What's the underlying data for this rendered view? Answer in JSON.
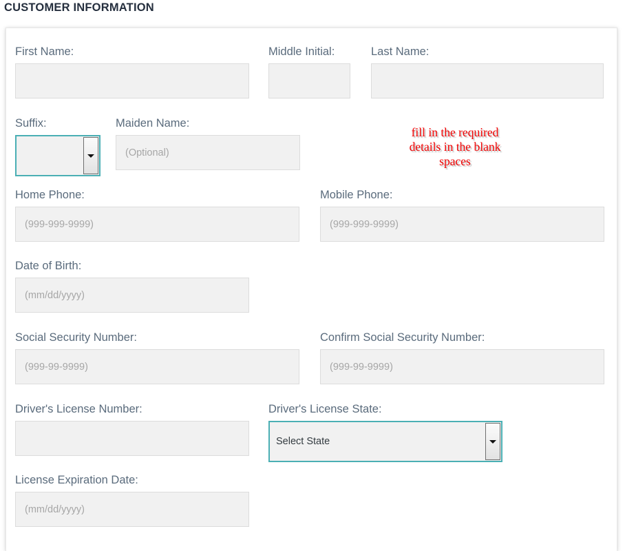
{
  "page": {
    "section_title": "CUSTOMER INFORMATION"
  },
  "annotation": {
    "text": "fill in the required\ndetails in the blank\nspaces",
    "color": "#ef0000"
  },
  "theme": {
    "label_color": "#5a6b7c",
    "input_bg": "#f1f1f1",
    "input_border": "#dcdcdc",
    "focus_border": "#4aafb4",
    "title_color": "#252f3e",
    "placeholder_color": "#a6a6a6"
  },
  "form": {
    "fields": [
      {
        "id": "first_name",
        "label": "First Name:",
        "type": "text",
        "value": "",
        "placeholder": ""
      },
      {
        "id": "middle_initial",
        "label": "Middle Initial:",
        "type": "text",
        "value": "",
        "placeholder": ""
      },
      {
        "id": "last_name",
        "label": "Last Name:",
        "type": "text",
        "value": "",
        "placeholder": ""
      },
      {
        "id": "suffix",
        "label": "Suffix:",
        "type": "select",
        "value": "",
        "placeholder": ""
      },
      {
        "id": "maiden_name",
        "label": "Maiden Name:",
        "type": "text",
        "value": "",
        "placeholder": "(Optional)"
      },
      {
        "id": "home_phone",
        "label": "Home Phone:",
        "type": "text",
        "value": "",
        "placeholder": "(999-999-9999)"
      },
      {
        "id": "mobile_phone",
        "label": "Mobile Phone:",
        "type": "text",
        "value": "",
        "placeholder": "(999-999-9999)"
      },
      {
        "id": "date_of_birth",
        "label": "Date of Birth:",
        "type": "text",
        "value": "",
        "placeholder": "(mm/dd/yyyy)"
      },
      {
        "id": "ssn",
        "label": "Social Security Number:",
        "type": "text",
        "value": "",
        "placeholder": "(999-99-9999)"
      },
      {
        "id": "confirm_ssn",
        "label": "Confirm Social Security Number:",
        "type": "text",
        "value": "",
        "placeholder": "(999-99-9999)"
      },
      {
        "id": "dl_number",
        "label": "Driver's License Number:",
        "type": "text",
        "value": "",
        "placeholder": ""
      },
      {
        "id": "dl_state",
        "label": "Driver's License State:",
        "type": "select",
        "value": "Select State",
        "placeholder": ""
      },
      {
        "id": "license_expiration",
        "label": "License Expiration Date:",
        "type": "text",
        "value": "",
        "placeholder": "(mm/dd/yyyy)"
      }
    ]
  },
  "icons": {
    "dropdown_arrow": "chevron-down-icon"
  }
}
